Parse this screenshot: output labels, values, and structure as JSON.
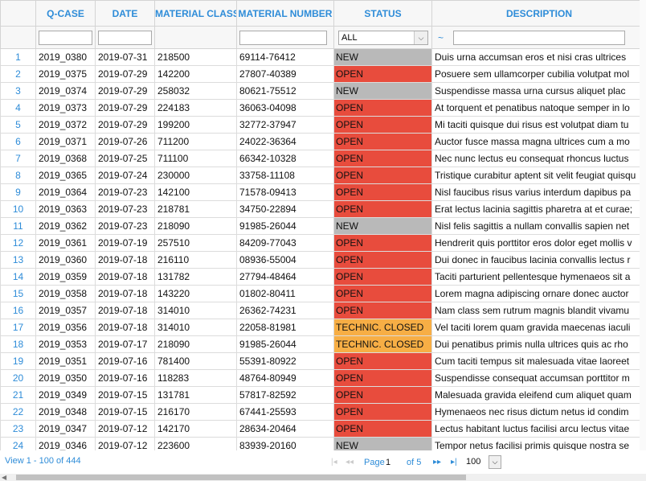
{
  "columns": [
    "",
    "Q-CASE",
    "DATE",
    "MATERIAL CLASS",
    "MATERIAL NUMBER",
    "STATUS",
    "DESCRIPTION"
  ],
  "filters": {
    "status_value": "ALL",
    "description_prefix": "~"
  },
  "colors": {
    "header_text": "#2e8cd8",
    "status_new": "#b9b9b9",
    "status_open": "#e84c3d",
    "status_technic_closed": "#f7ae45"
  },
  "rows": [
    {
      "n": "1",
      "qcase": "2019_0380",
      "date": "2019-07-31",
      "mclass": "218500",
      "mnum": "69114-76412",
      "status": "NEW",
      "desc": "Duis urna accumsan eros et nisi cras ultrices"
    },
    {
      "n": "2",
      "qcase": "2019_0375",
      "date": "2019-07-29",
      "mclass": "142200",
      "mnum": "27807-40389",
      "status": "OPEN",
      "desc": "Posuere sem ullamcorper cubilia volutpat mol"
    },
    {
      "n": "3",
      "qcase": "2019_0374",
      "date": "2019-07-29",
      "mclass": "258032",
      "mnum": "80621-75512",
      "status": "NEW",
      "desc": "Suspendisse massa urna cursus aliquet plac"
    },
    {
      "n": "4",
      "qcase": "2019_0373",
      "date": "2019-07-29",
      "mclass": "224183",
      "mnum": "36063-04098",
      "status": "OPEN",
      "desc": "At torquent et penatibus natoque semper in lo"
    },
    {
      "n": "5",
      "qcase": "2019_0372",
      "date": "2019-07-29",
      "mclass": "199200",
      "mnum": "32772-37947",
      "status": "OPEN",
      "desc": "Mi taciti quisque dui risus est volutpat diam tu"
    },
    {
      "n": "6",
      "qcase": "2019_0371",
      "date": "2019-07-26",
      "mclass": "711200",
      "mnum": "24022-36364",
      "status": "OPEN",
      "desc": "Auctor fusce massa magna ultrices cum a mo"
    },
    {
      "n": "7",
      "qcase": "2019_0368",
      "date": "2019-07-25",
      "mclass": "711100",
      "mnum": "66342-10328",
      "status": "OPEN",
      "desc": "Nec nunc lectus eu consequat rhoncus luctus"
    },
    {
      "n": "8",
      "qcase": "2019_0365",
      "date": "2019-07-24",
      "mclass": "230000",
      "mnum": "33758-11108",
      "status": "OPEN",
      "desc": "Tristique curabitur aptent sit velit feugiat quisqu"
    },
    {
      "n": "9",
      "qcase": "2019_0364",
      "date": "2019-07-23",
      "mclass": "142100",
      "mnum": "71578-09413",
      "status": "OPEN",
      "desc": "Nisl faucibus risus varius interdum dapibus pa"
    },
    {
      "n": "10",
      "qcase": "2019_0363",
      "date": "2019-07-23",
      "mclass": "218781",
      "mnum": "34750-22894",
      "status": "OPEN",
      "desc": "Erat lectus lacinia sagittis pharetra at et curae;"
    },
    {
      "n": "11",
      "qcase": "2019_0362",
      "date": "2019-07-23",
      "mclass": "218090",
      "mnum": "91985-26044",
      "status": "NEW",
      "desc": "Nisl felis sagittis a nullam convallis sapien net"
    },
    {
      "n": "12",
      "qcase": "2019_0361",
      "date": "2019-07-19",
      "mclass": "257510",
      "mnum": "84209-77043",
      "status": "OPEN",
      "desc": "Hendrerit quis porttitor eros dolor eget mollis v"
    },
    {
      "n": "13",
      "qcase": "2019_0360",
      "date": "2019-07-18",
      "mclass": "216110",
      "mnum": "08936-55004",
      "status": "OPEN",
      "desc": "Dui donec in faucibus lacinia convallis lectus r"
    },
    {
      "n": "14",
      "qcase": "2019_0359",
      "date": "2019-07-18",
      "mclass": "131782",
      "mnum": "27794-48464",
      "status": "OPEN",
      "desc": "Taciti parturient pellentesque hymenaeos sit a"
    },
    {
      "n": "15",
      "qcase": "2019_0358",
      "date": "2019-07-18",
      "mclass": "143220",
      "mnum": "01802-80411",
      "status": "OPEN",
      "desc": "Lorem magna adipiscing ornare donec auctor"
    },
    {
      "n": "16",
      "qcase": "2019_0357",
      "date": "2019-07-18",
      "mclass": "314010",
      "mnum": "26362-74231",
      "status": "OPEN",
      "desc": "Nam class sem rutrum magnis blandit vivamu"
    },
    {
      "n": "17",
      "qcase": "2019_0356",
      "date": "2019-07-18",
      "mclass": "314010",
      "mnum": "22058-81981",
      "status": "TECHNIC. CLOSED",
      "desc": "Vel taciti lorem quam gravida maecenas iaculi"
    },
    {
      "n": "18",
      "qcase": "2019_0353",
      "date": "2019-07-17",
      "mclass": "218090",
      "mnum": "91985-26044",
      "status": "TECHNIC. CLOSED",
      "desc": "Dui penatibus primis nulla ultrices quis ac rho"
    },
    {
      "n": "19",
      "qcase": "2019_0351",
      "date": "2019-07-16",
      "mclass": "781400",
      "mnum": "55391-80922",
      "status": "OPEN",
      "desc": "Cum taciti tempus sit malesuada vitae laoreet"
    },
    {
      "n": "20",
      "qcase": "2019_0350",
      "date": "2019-07-16",
      "mclass": "118283",
      "mnum": "48764-80949",
      "status": "OPEN",
      "desc": "Suspendisse consequat accumsan porttitor m"
    },
    {
      "n": "21",
      "qcase": "2019_0349",
      "date": "2019-07-15",
      "mclass": "131781",
      "mnum": "57817-82592",
      "status": "OPEN",
      "desc": "Malesuada gravida eleifend cum aliquet quam"
    },
    {
      "n": "22",
      "qcase": "2019_0348",
      "date": "2019-07-15",
      "mclass": "216170",
      "mnum": "67441-25593",
      "status": "OPEN",
      "desc": "Hymenaeos nec risus dictum netus id condim"
    },
    {
      "n": "23",
      "qcase": "2019_0347",
      "date": "2019-07-12",
      "mclass": "142170",
      "mnum": "28634-20464",
      "status": "OPEN",
      "desc": "Lectus habitant luctus facilisi arcu lectus vitae"
    },
    {
      "n": "24",
      "qcase": "2019_0346",
      "date": "2019-07-12",
      "mclass": "223600",
      "mnum": "83939-20160",
      "status": "NEW",
      "desc": "Tempor netus facilisi primis quisque nostra se"
    }
  ],
  "pager": {
    "info": "View 1 - 100 of 444",
    "page_label": "Page",
    "page_value": "1",
    "of_label": "of 5",
    "next_icon": "▸▸",
    "last_icon": "▸|",
    "first_icon": "|◂",
    "prev_icon": "◂◂",
    "rows_per_page": "100"
  }
}
